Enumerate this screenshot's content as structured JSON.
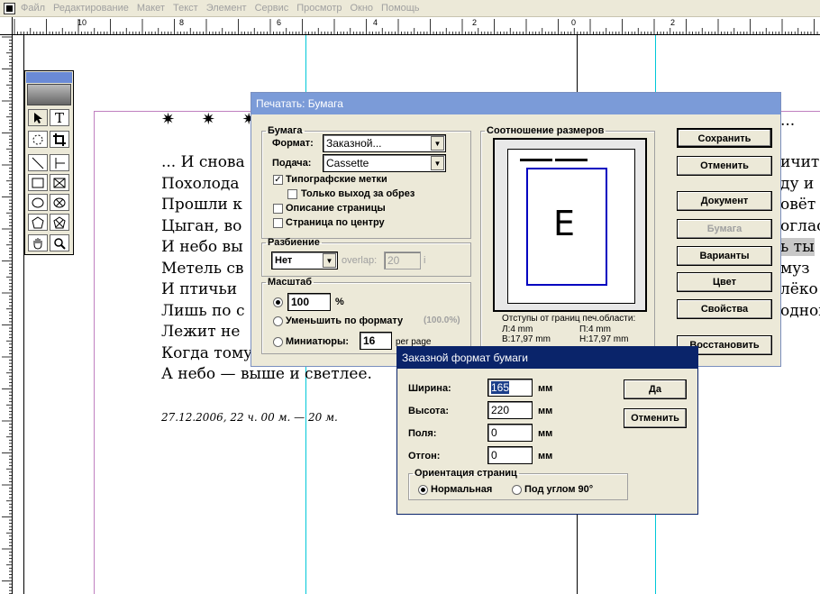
{
  "menubar": {
    "items": [
      "Файл",
      "Редактирование",
      "Макет",
      "Текст",
      "Элемент",
      "Сервис",
      "Просмотр",
      "Окно",
      "Помощь"
    ]
  },
  "ruler": {
    "labels": [
      "10",
      "8",
      "6",
      "4",
      "2",
      "0",
      "2"
    ]
  },
  "page": {
    "stars": "✷ ✷ ✷",
    "lines": [
      "... И снова",
      "Похолода",
      "Прошли к",
      "Цыган, во",
      "И небо вы",
      "Метель св",
      "И птичьи",
      "Лишь по с",
      "Лежит не",
      "Когда тому настанет срок",
      "А небо — выше и светлее."
    ],
    "right_fragments": [
      "...",
      "ичит",
      "ду и",
      "овёт",
      "оглас",
      "ь ты",
      "муз",
      "лёко",
      "одной"
    ],
    "date": "27.12.2006, 22 ч. 00 м. — 20 м."
  },
  "toolbox": {
    "tools": [
      "pointer",
      "text",
      "rotate",
      "crop",
      "line",
      "perp-line",
      "rect",
      "rect-frame",
      "ellipse",
      "ellipse-frame",
      "polygon",
      "polygon-frame",
      "hand",
      "zoom"
    ]
  },
  "print_dialog": {
    "title": "Печатать: Бумага",
    "paper_group": "Бумага",
    "format_label": "Формат:",
    "format_value": "Заказной...",
    "feed_label": "Подача:",
    "feed_value": "Cassette",
    "printer_marks": "Типографские метки",
    "bleed_only": "Только выход за обрез",
    "page_info": "Описание страницы",
    "center_page": "Страница по центру",
    "tiling_group": "Разбиение",
    "tiling_value": "Нет",
    "overlap_label": "overlap:",
    "overlap_value": "20",
    "overlap_unit": "i",
    "scale_group": "Масштаб",
    "scale_value": "100",
    "scale_unit": "%",
    "reduce_to_fit": "Уменьшить по формату",
    "reduce_value": "(100.0%)",
    "thumbnails": "Миниатюры:",
    "thumbnails_value": "16",
    "per_page": "per page",
    "ratio_group": "Соотношение размеров",
    "preview_letter": "E",
    "offsets_title": "Отступы от границ печ.области:",
    "offset_l": "Л:4 mm",
    "offset_p": "П:4 mm",
    "offset_t": "В:17,97 mm",
    "offset_b": "Н:17,97 mm",
    "buttons": {
      "save": "Сохранить",
      "cancel": "Отменить",
      "document": "Документ",
      "paper": "Бумага",
      "options": "Варианты",
      "color": "Цвет",
      "properties": "Свойства",
      "restore": "Восстановить"
    }
  },
  "custom_dialog": {
    "title": "Заказной формат бумаги",
    "width_label": "Ширина:",
    "width_value": "165",
    "height_label": "Высота:",
    "height_value": "220",
    "margins_label": "Поля:",
    "margins_value": "0",
    "gutter_label": "Отгон:",
    "gutter_value": "0",
    "unit": "мм",
    "ok": "Да",
    "cancel": "Отменить",
    "orientation_group": "Ориентация страниц",
    "portrait": "Нормальная",
    "landscape": "Под углом 90°"
  },
  "colors": {
    "guide_cyan": "#00c8d8",
    "margin_magenta": "#c080c0",
    "dialog_title_active": "#0a246a",
    "dialog_title_inactive": "#7b9bd8",
    "preview_frame": "#0000c0"
  }
}
